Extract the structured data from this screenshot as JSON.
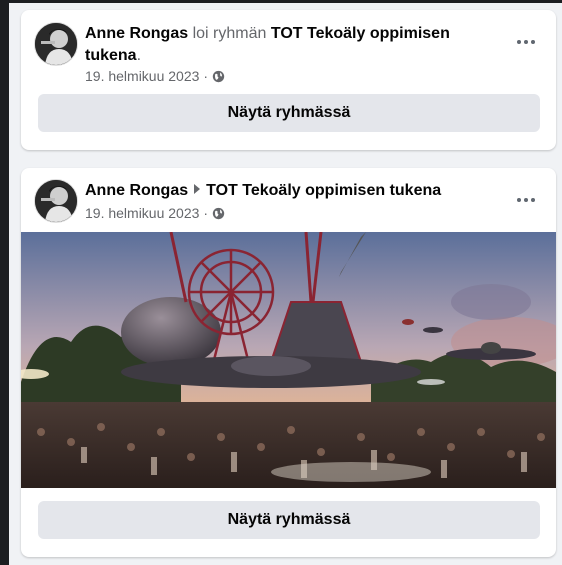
{
  "posts": [
    {
      "author": "Anne Rongas",
      "action": "loi ryhmän",
      "group": "TOT Tekoäly oppimisen tukena",
      "suffix": ".",
      "date": "19. helmikuu 2023",
      "separator": "·",
      "privacy_icon": "globe-icon",
      "button_label": "Näytä ryhmässä"
    },
    {
      "author": "Anne Rongas",
      "group": "TOT Tekoäly oppimisen tukena",
      "date": "19. helmikuu 2023",
      "separator": "·",
      "privacy_icon": "globe-icon",
      "image_icon": "ai-generated-image",
      "button_label": "Näytä ryhmässä"
    }
  ],
  "colors": {
    "background": "#f0f2f5",
    "card": "#ffffff",
    "button": "#e4e6eb",
    "secondary_text": "#65676b",
    "primary_text": "#050505"
  }
}
